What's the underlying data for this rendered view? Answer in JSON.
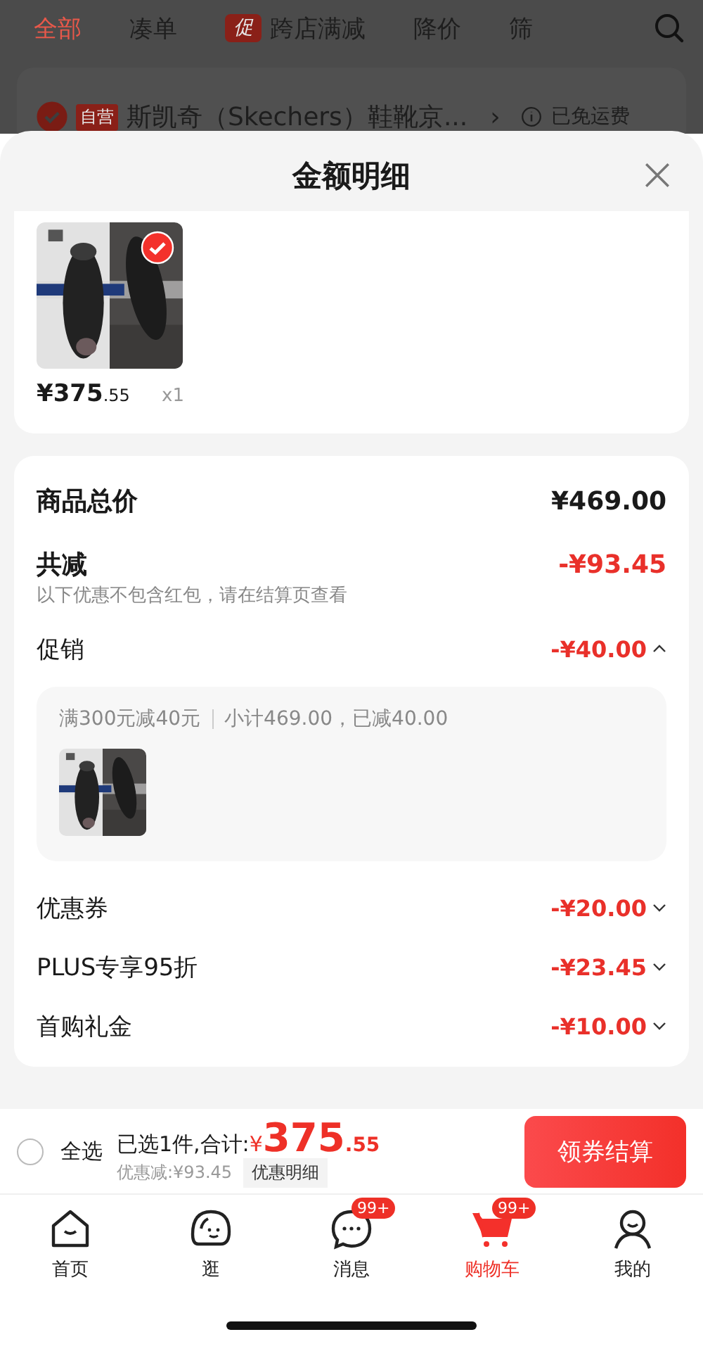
{
  "filter_bar": {
    "tabs": [
      {
        "label": "全部",
        "selected": true
      },
      {
        "label": "凑单",
        "selected": false
      },
      {
        "label": "跨店满减",
        "badge": "促",
        "selected": false
      },
      {
        "label": "降价",
        "selected": false
      },
      {
        "label": "筛",
        "selected": false
      }
    ]
  },
  "store_row": {
    "checked": true,
    "tag": "自营",
    "name": "斯凯奇（Skechers）鞋靴京...",
    "arrow": "›",
    "shipping": "已免运费"
  },
  "sheet": {
    "title": "金额明细",
    "items": [
      {
        "kind": "picture",
        "checked": true,
        "price": "¥375",
        "price_decimal": ".55",
        "quantity": "x1"
      }
    ],
    "total": {
      "label": "商品总价",
      "amount": "¥469.00"
    },
    "discount": {
      "label": "共减",
      "amount": "-¥93.45",
      "note": "以下优惠不包含红包，请在结算页查看"
    },
    "lines": [
      {
        "label": "促销",
        "amount": "-¥40.00",
        "expanded": true,
        "detail": {
          "rule": "满300元减40元",
          "summary": "小计469.00，已减40.00"
        }
      },
      {
        "label": "优惠券",
        "amount": "-¥20.00",
        "expanded": false
      },
      {
        "label": "PLUS专享95折",
        "amount": "-¥23.45",
        "expanded": false
      },
      {
        "label": "首购礼金",
        "amount": "-¥10.00",
        "expanded": false
      }
    ]
  },
  "checkout_bar": {
    "select_all": {
      "label": "全选",
      "checked": false
    },
    "selected_text": "已选1件,合计:",
    "currency": "¥",
    "total": "375",
    "total_decimal": ".55",
    "saving": "优惠减:¥93.45",
    "details_button": "优惠明细",
    "checkout_button": "领券结算"
  },
  "tab_bar": {
    "items": [
      {
        "kind": "home",
        "label": "首页",
        "selected": false
      },
      {
        "kind": "browse",
        "label": "逛",
        "selected": false
      },
      {
        "kind": "messages",
        "label": "消息",
        "badge": "99+",
        "selected": false
      },
      {
        "kind": "cart",
        "label": "购物车",
        "badge": "99+",
        "selected": true
      },
      {
        "kind": "me",
        "label": "我的",
        "selected": false
      }
    ]
  }
}
